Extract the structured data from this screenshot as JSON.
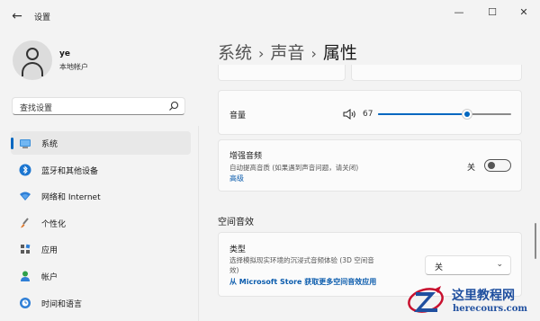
{
  "window": {
    "title": "设置",
    "back_glyph": "←",
    "minimize_glyph": "—",
    "maximize_glyph": "☐",
    "close_glyph": "✕"
  },
  "profile": {
    "name": "ye",
    "account_type": "本地帐户"
  },
  "search": {
    "placeholder": "查找设置",
    "icon": "search-icon"
  },
  "sidebar": {
    "items": [
      {
        "label": "系统",
        "icon": "monitor-icon",
        "active": true
      },
      {
        "label": "蓝牙和其他设备",
        "icon": "bluetooth-icon"
      },
      {
        "label": "网络和 Internet",
        "icon": "wifi-icon"
      },
      {
        "label": "个性化",
        "icon": "brush-icon"
      },
      {
        "label": "应用",
        "icon": "apps-icon"
      },
      {
        "label": "帐户",
        "icon": "person-icon"
      },
      {
        "label": "时间和语言",
        "icon": "clock-globe-icon"
      }
    ]
  },
  "breadcrumb": {
    "items": [
      "系统",
      "声音",
      "属性"
    ],
    "separator": "›"
  },
  "volume": {
    "label": "音量",
    "value": "67",
    "level": 0.67,
    "icon": "speaker-icon"
  },
  "enhance": {
    "title": "增强音频",
    "description": "自动提高音质 (如果遇到声音问题，请关闭)",
    "link": "高级",
    "state_label": "关",
    "on": false
  },
  "spatial": {
    "section_title": "空间音效",
    "type_title": "类型",
    "type_description_line1": "选择模拟现实环境的沉浸式音频体验 (3D 空间音",
    "type_description_line2": "效)",
    "selected": "关",
    "store_link": "从 Microsoft Store 获取更多空间音效应用"
  },
  "watermark": {
    "title": "这里教程网",
    "url": "herecours.com"
  },
  "colors": {
    "accent": "#0067c0",
    "link": "#0b5cad",
    "watermark": "#1f4f9f"
  }
}
